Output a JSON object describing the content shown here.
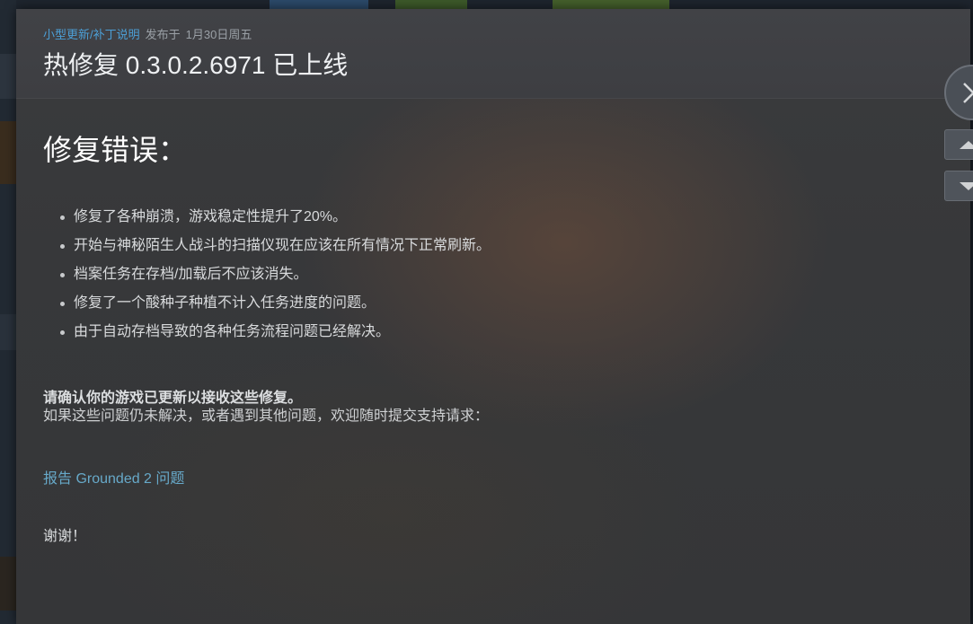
{
  "announcement": {
    "type_label": "小型更新/补丁说明",
    "posted_label": "发布于",
    "date": "1月30日周五",
    "title": "热修复 0.3.0.2.6971 已上线"
  },
  "content": {
    "section_heading": "修复错误：",
    "fixes": [
      "修复了各种崩溃，游戏稳定性提升了20%。",
      "开始与神秘陌生人战斗的扫描仪现在应该在所有情况下正常刷新。",
      "档案任务在存档/加载后不应该消失。",
      "修复了一个酸种子种植不计入任务进度的问题。",
      "由于自动存档导致的各种任务流程问题已经解决。"
    ],
    "confirm_text": "请确认你的游戏已更新以接收这些修复。",
    "help_text": "如果这些问题仍未解决，或者遇到其他问题，欢迎随时提交支持请求：",
    "report_link": "报告 Grounded 2 问题",
    "thanks": "谢谢！"
  },
  "controls": {
    "close_icon": "close-icon",
    "prev_icon": "chevron-up-icon",
    "next_icon": "chevron-down-icon"
  },
  "colors": {
    "link": "#4c9fd6",
    "report_link": "#67a9c9",
    "modal_bg": "#38393b"
  }
}
